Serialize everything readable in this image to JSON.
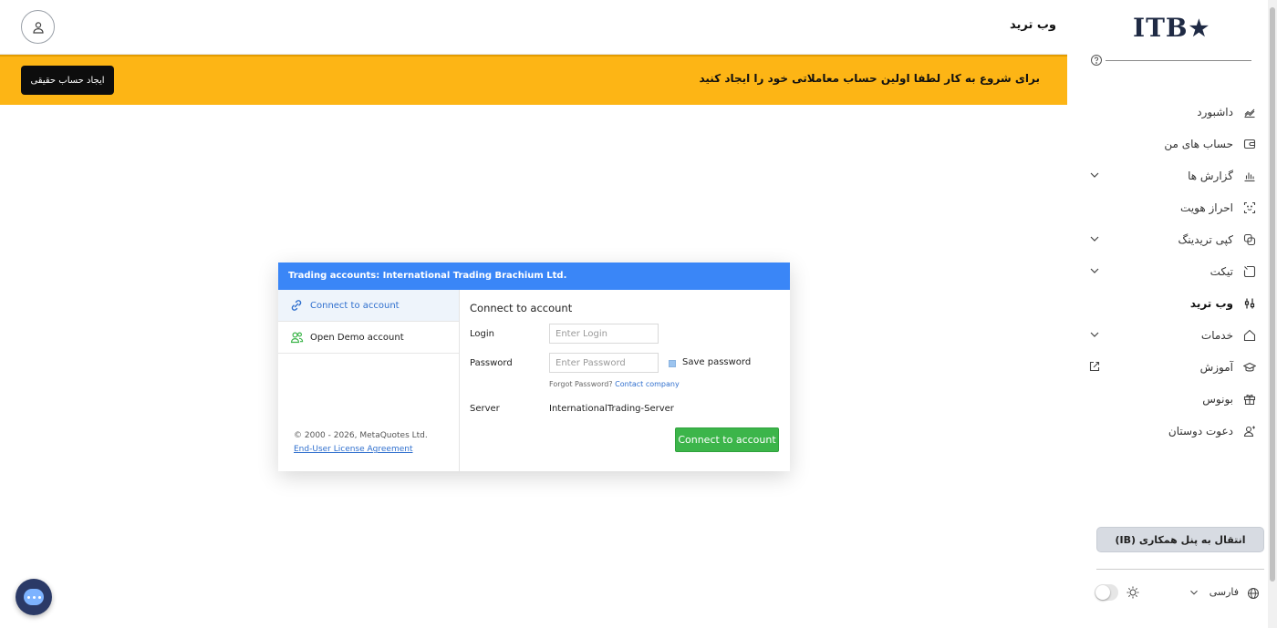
{
  "header": {
    "page_title": "وب ترید"
  },
  "banner": {
    "text": "برای شروع به کار لطفا اولین حساب معاملاتی خود را ایجاد کنید",
    "button_label": "ایجاد حساب حقیقی",
    "color": "#fdb515"
  },
  "sidebar": {
    "logo_text": "ITB",
    "items": [
      {
        "label": "داشبورد",
        "icon": "chart-icon",
        "has_chevron": false,
        "active": false
      },
      {
        "label": "حساب های من",
        "icon": "wallet-icon",
        "has_chevron": false,
        "active": false
      },
      {
        "label": "گزارش ها",
        "icon": "bar-chart-icon",
        "has_chevron": true,
        "active": false
      },
      {
        "label": "احراز هویت",
        "icon": "face-scan-icon",
        "has_chevron": false,
        "active": false
      },
      {
        "label": "کپی تریدینگ",
        "icon": "copy-icon",
        "has_chevron": true,
        "active": false
      },
      {
        "label": "تیکت",
        "icon": "ticket-icon",
        "has_chevron": true,
        "active": false
      },
      {
        "label": "وب ترید",
        "icon": "sliders-icon",
        "has_chevron": false,
        "active": true
      },
      {
        "label": "خدمات",
        "icon": "home-icon",
        "has_chevron": true,
        "active": false
      },
      {
        "label": "آموزش",
        "icon": "graduation-cap-icon",
        "has_external": true,
        "active": false
      },
      {
        "label": "بونوس",
        "icon": "gift-icon",
        "has_chevron": false,
        "active": false
      },
      {
        "label": "دعوت دوستان",
        "icon": "add-user-icon",
        "has_chevron": false,
        "active": false
      }
    ],
    "ib_button_label": "انتقال به پنل همکاری (IB)",
    "language_label": "فارسی"
  },
  "dialog": {
    "header": "Trading accounts: International Trading Brachium Ltd.",
    "header_color": "#3a86f7",
    "tabs": [
      {
        "label": "Connect to account",
        "icon": "link-icon"
      },
      {
        "label": "Open Demo account",
        "icon": "users-icon"
      }
    ],
    "copyright": "© 2000 - 2026, MetaQuotes Ltd.",
    "eula": "End-User License Agreement",
    "title": "Connect to account",
    "login_label": "Login",
    "login_placeholder": "Enter Login",
    "password_label": "Password",
    "password_placeholder": "Enter Password",
    "save_password_label": "Save password",
    "forgot_text": "Forgot Password?",
    "contact_link": "Contact company",
    "server_label": "Server",
    "server_value": "InternationalTrading-Server",
    "connect_button": "Connect to account",
    "connect_color": "#3cb54a"
  }
}
